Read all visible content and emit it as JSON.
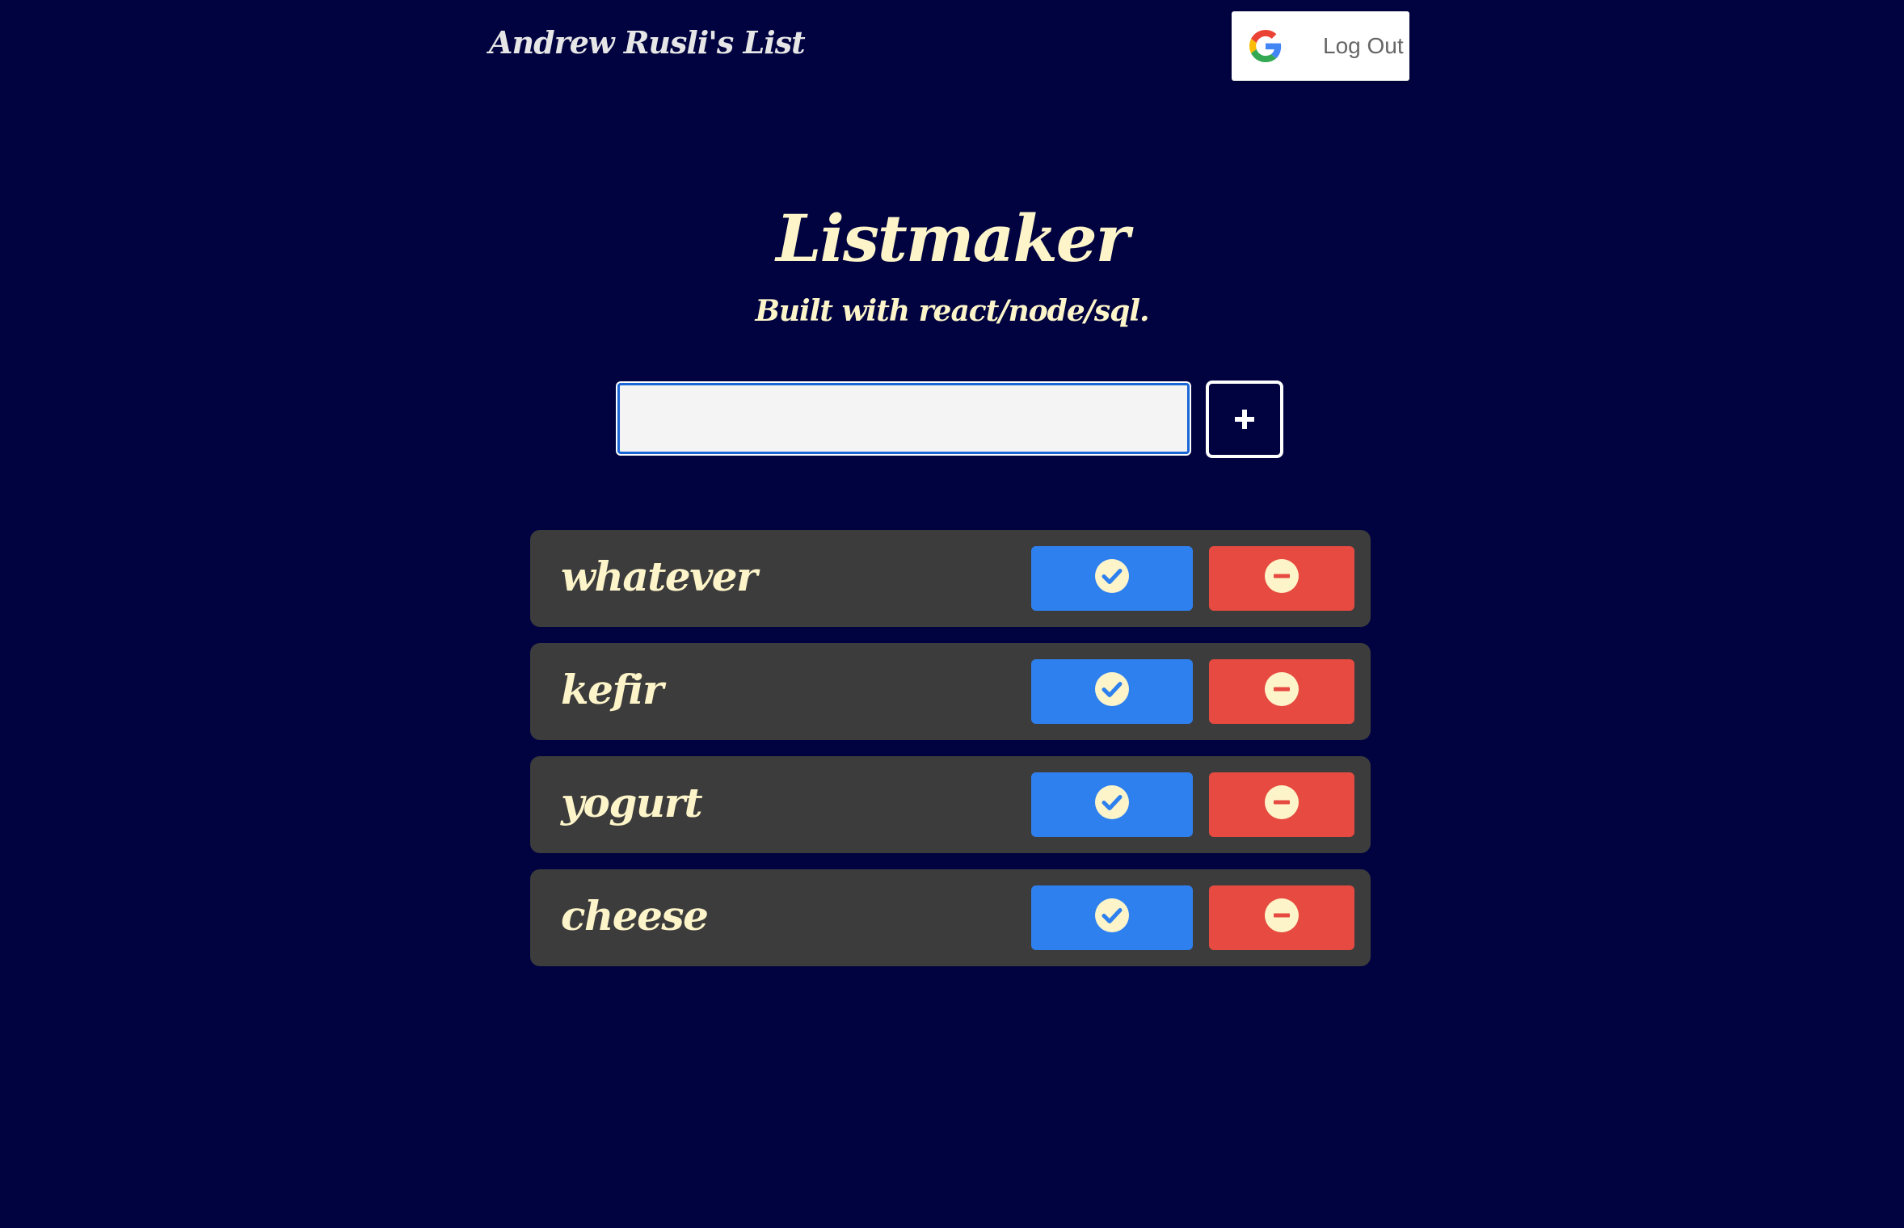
{
  "header": {
    "owner_title": "Andrew Rusli's List",
    "logout_label": "Log Out",
    "logout_icon": "google-icon"
  },
  "main": {
    "title": "Listmaker",
    "subtitle": "Built with react/node/sql.",
    "new_item_input": {
      "value": "",
      "placeholder": ""
    },
    "add_button_icon": "plus-icon"
  },
  "items": [
    {
      "text": "whatever"
    },
    {
      "text": "kefir"
    },
    {
      "text": "yogurt"
    },
    {
      "text": "cheese"
    }
  ],
  "item_actions": {
    "done_icon": "check-circle-icon",
    "delete_icon": "minus-circle-icon"
  },
  "colors": {
    "background": "#000340",
    "text_cream": "#fdf5c9",
    "item_background": "#3c3c3c",
    "done_blue": "#2f80ef",
    "delete_red": "#e64a40",
    "input_focus_ring": "#1a66d6"
  }
}
